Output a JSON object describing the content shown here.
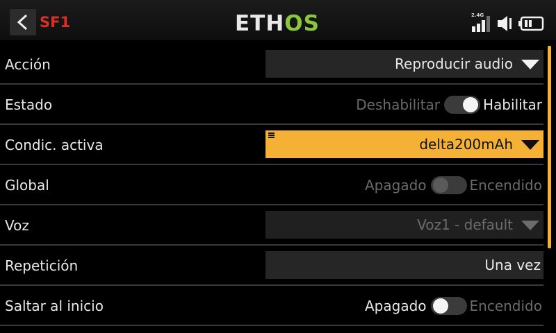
{
  "header": {
    "title": "SF1",
    "logo_part1": "ETH",
    "logo_part2": "OS",
    "band": "2.4G"
  },
  "colors": {
    "accent": "#f5b135",
    "title_red": "#e12b25",
    "logo_green": "#8cc63f"
  },
  "icons": [
    "back-arrow-icon",
    "signal-icon",
    "speaker-icon",
    "battery-icon"
  ],
  "rows": [
    {
      "label": "Acción",
      "type": "dropdown",
      "value": "Reproducir audio"
    },
    {
      "label": "Estado",
      "type": "toggle",
      "off_label": "Deshabilitar",
      "on_label": "Habilitar",
      "state": "on"
    },
    {
      "label": "Condic. activa",
      "type": "dropdown",
      "value": "delta200mAh",
      "focused": true
    },
    {
      "label": "Global",
      "type": "toggle",
      "off_label": "Apagado",
      "on_label": "Encendido",
      "state": "off",
      "disabled": true
    },
    {
      "label": "Voz",
      "type": "dropdown",
      "value": "Voz1 - default",
      "disabled": true
    },
    {
      "label": "Repetición",
      "type": "field",
      "value": "Una vez"
    },
    {
      "label": "Saltar al inicio",
      "type": "toggle",
      "off_label": "Apagado",
      "on_label": "Encendido",
      "state": "off"
    }
  ]
}
